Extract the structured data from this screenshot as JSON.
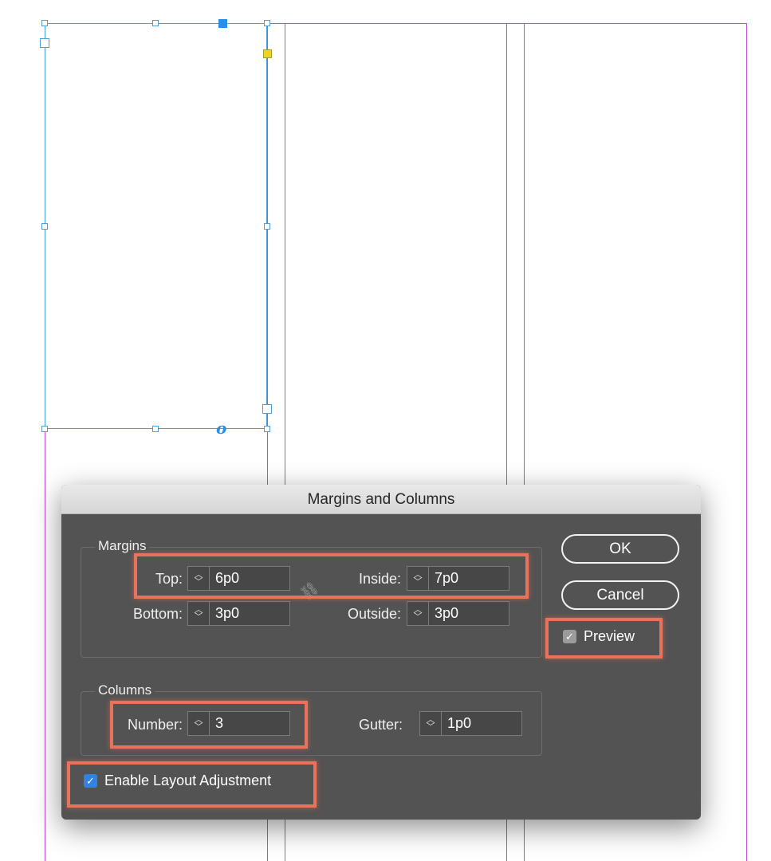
{
  "dialog": {
    "title": "Margins and Columns",
    "margins": {
      "group_label": "Margins",
      "top_label": "Top:",
      "top_value": "6p0",
      "bottom_label": "Bottom:",
      "bottom_value": "3p0",
      "inside_label": "Inside:",
      "inside_value": "7p0",
      "outside_label": "Outside:",
      "outside_value": "3p0",
      "link_icon": "broken-chain-link-icon"
    },
    "columns": {
      "group_label": "Columns",
      "number_label": "Number:",
      "number_value": "3",
      "gutter_label": "Gutter:",
      "gutter_value": "1p0"
    },
    "ok_label": "OK",
    "cancel_label": "Cancel",
    "preview_label": "Preview",
    "preview_checked": true,
    "enable_layout_label": "Enable Layout Adjustment",
    "enable_layout_checked": true
  },
  "canvas": {
    "overset_marker": "o",
    "guide_color": "#c04ad9",
    "frame_color": "#4a9fdc",
    "highlight_color": "#e8735a"
  }
}
